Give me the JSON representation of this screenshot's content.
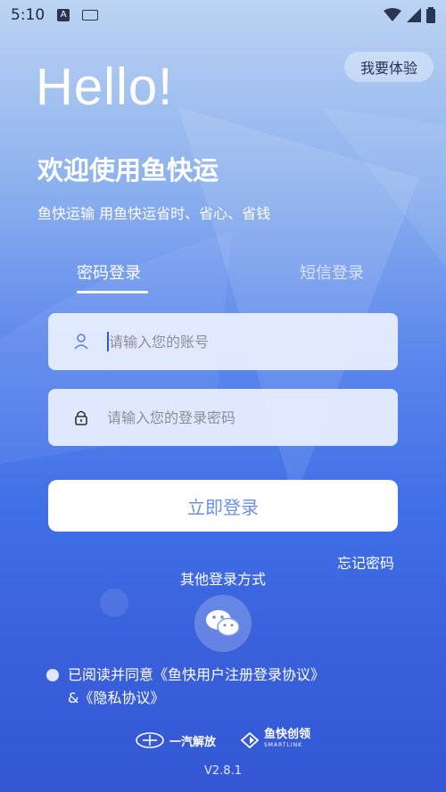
{
  "status_bar": {
    "time": "5:10",
    "a_badge": "A"
  },
  "header": {
    "trial_label": "我要体验",
    "hello": "Hello!",
    "welcome": "欢迎使用鱼快运",
    "subtitle": "鱼快运输 用鱼快运省时、省心、省钱"
  },
  "tabs": [
    {
      "label": "密码登录",
      "active": true
    },
    {
      "label": "短信登录",
      "active": false
    }
  ],
  "form": {
    "account_placeholder": "请输入您的账号",
    "password_placeholder": "请输入您的登录密码",
    "login_label": "立即登录",
    "forgot_label": "忘记密码"
  },
  "other_login": {
    "title": "其他登录方式",
    "icon": "wechat-icon"
  },
  "agreement": {
    "prefix": "已阅读并同意",
    "user_agreement": "《鱼快用户注册登录协议》",
    "and": "&",
    "privacy": "《隐私协议》"
  },
  "footer": {
    "logo1": "一汽解放",
    "logo2": "鱼快创领",
    "logo2_sub": "SMARTLINK",
    "version": "V2.8.1"
  },
  "colors": {
    "accent": "#3f6fe6",
    "button_text": "#6b8ee8"
  }
}
